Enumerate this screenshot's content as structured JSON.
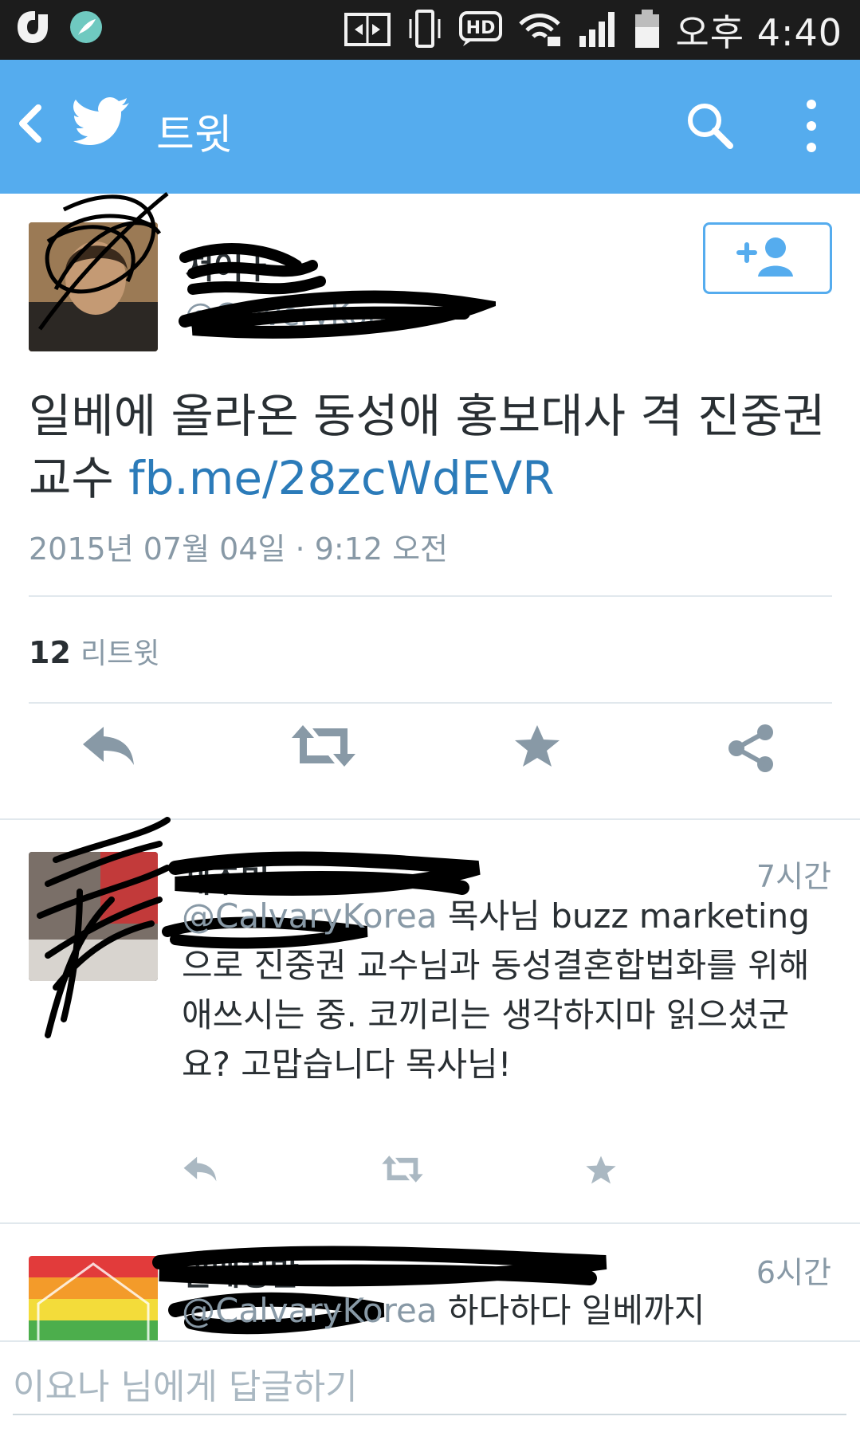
{
  "status_bar": {
    "time": "오후 4:40",
    "hd_label": "HD",
    "icons": [
      "olleh-icon",
      "feather-app-icon",
      "screen-share-icon",
      "vibrate-icon",
      "hd-voice-icon",
      "wifi-lock-icon",
      "signal-icon",
      "battery-icon"
    ]
  },
  "app_bar": {
    "title": "트윗",
    "back_icon": "chevron-left-icon",
    "logo_icon": "twitter-bird-icon",
    "search_icon": "search-icon",
    "more_icon": "more-vertical-icon",
    "color": "#55acee"
  },
  "main_tweet": {
    "author_name": "쳐어ㅏ",
    "author_handle": "@CalveryKorea",
    "text": "일베에 올라온 동성애 홍보대사 격 진중권 교수 ",
    "link": "fb.me/28zcWdEVR",
    "timestamp": "2015년 07월 04일 · 9:12 오전",
    "retweet_count": "12",
    "retweet_label": "리트윗",
    "follow_icon": "add-user-icon",
    "actions": [
      "reply-icon",
      "retweet-icon",
      "favorite-icon",
      "share-icon"
    ]
  },
  "replies": [
    {
      "name": "제주민",
      "age": "7시간",
      "handle": "@CalvaryKorea",
      "text": " 목사님 buzz marketing으로 진중권 교수님과 동성결혼합법화를 위해 애쓰시는 중. 코끼리는 생각하지마 읽으셨군요? 고맙습니다 목사님!"
    },
    {
      "name": "일베정말",
      "age": "6시간",
      "handle": "@CalvaryKorea",
      "text": " 하다하다 일베까지"
    }
  ],
  "compose": {
    "placeholder": "이요나 님에게 답글하기"
  },
  "colors": {
    "accent": "#55acee",
    "link": "#2b7bb9",
    "muted": "#8899a6",
    "text": "#292f33",
    "divider": "#e1e8ed"
  }
}
